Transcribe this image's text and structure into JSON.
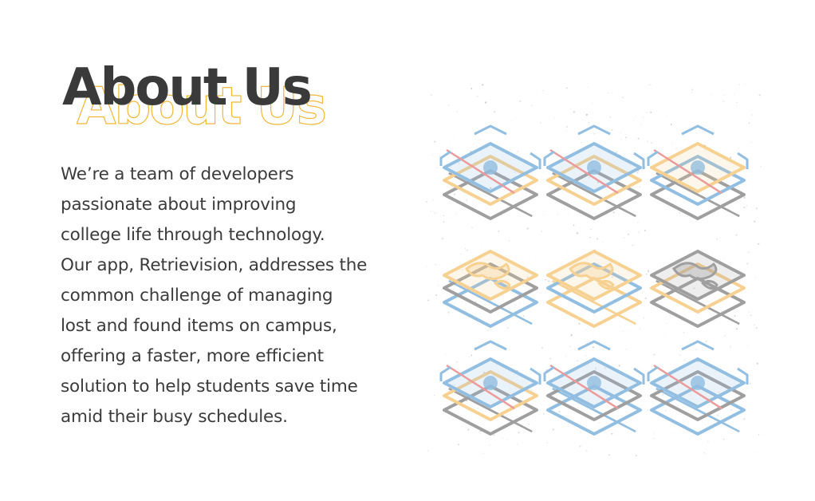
{
  "heading": "About Us",
  "paragraph_lines": [
    "We’re a team of developers",
    "passionate about improving",
    "college life through technology.",
    "Our app, Retrievision, addresses the",
    "common challenge of managing",
    "lost and found items on campus,",
    "offering a faster, more efficient",
    "solution to help students save time",
    "amid their busy schedules."
  ],
  "colors": {
    "heading": "#3a3a3a",
    "outline": "#f0b73a",
    "text": "#3b3b3b",
    "blue": "#7fb3dc",
    "orange": "#f5c97e",
    "gray": "#8f8f8f",
    "red": "#e88a8a"
  },
  "illustration": {
    "icon": "layered-isometric-tiles-illustration",
    "tiles": [
      {
        "variant": "scan",
        "colors": [
          "blue",
          "orange",
          "gray"
        ]
      },
      {
        "variant": "scan",
        "colors": [
          "blue",
          "orange",
          "gray"
        ]
      },
      {
        "variant": "scan",
        "colors": [
          "orange",
          "blue",
          "gray"
        ]
      },
      {
        "variant": "map",
        "colors": [
          "orange",
          "gray",
          "blue"
        ]
      },
      {
        "variant": "map",
        "colors": [
          "orange",
          "blue",
          "orange"
        ]
      },
      {
        "variant": "map",
        "colors": [
          "gray",
          "orange",
          "gray"
        ]
      },
      {
        "variant": "scan",
        "colors": [
          "blue",
          "orange",
          "gray"
        ]
      },
      {
        "variant": "scan",
        "colors": [
          "blue",
          "gray",
          "blue"
        ]
      },
      {
        "variant": "scan",
        "colors": [
          "blue",
          "gray",
          "blue"
        ]
      }
    ]
  }
}
